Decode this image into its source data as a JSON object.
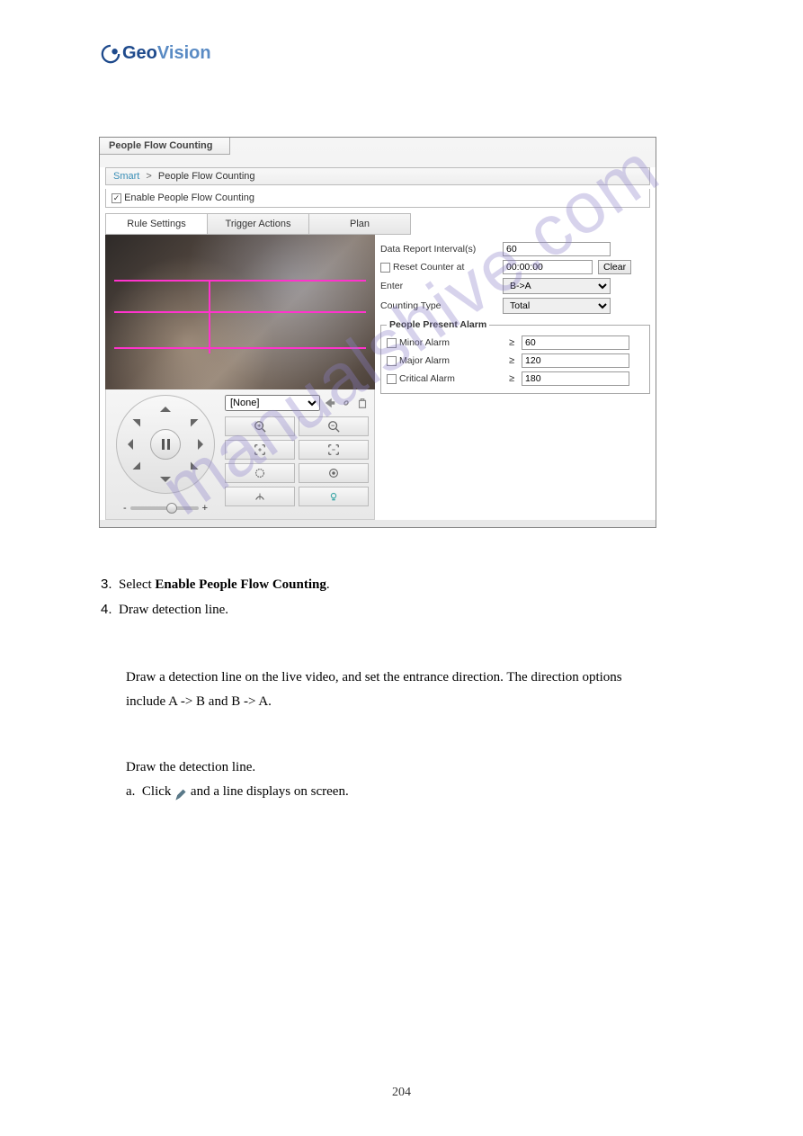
{
  "logo": {
    "brand_a": "Geo",
    "brand_b": "Vision"
  },
  "panel": {
    "tab_title": "People Flow Counting",
    "breadcrumb": {
      "link": "Smart",
      "sep": ">",
      "current": "People Flow Counting"
    },
    "enable_label": "Enable People Flow Counting",
    "tabs": {
      "rule": "Rule Settings",
      "trigger": "Trigger Actions",
      "plan": "Plan"
    },
    "preset_none": "[None]",
    "slider_minus": "-",
    "slider_plus": "+",
    "form": {
      "interval_label": "Data Report Interval(s)",
      "interval_value": "60",
      "reset_label": "Reset Counter at",
      "reset_value": "00:00:00",
      "clear_btn": "Clear",
      "enter_label": "Enter",
      "enter_value": "B->A",
      "counting_label": "Counting Type",
      "counting_value": "Total"
    },
    "alarm": {
      "legend": "People Present Alarm",
      "minor_label": "Minor Alarm",
      "minor_value": "60",
      "major_label": "Major Alarm",
      "major_value": "120",
      "critical_label": "Critical Alarm",
      "critical_value": "180",
      "ge": "≥"
    }
  },
  "body": {
    "p1_a": "3.",
    "p1_b": "Select ",
    "p1_c": "Enable People Flow Counting",
    "p1_d": ".",
    "p2_a": "4.",
    "p2_b": "Draw detection line.",
    "p3": "Draw a detection line on the live video, and set the entrance direction. The direction options include A -> B and B -> A.",
    "p4": "Draw the detection line.",
    "p5_a": "a.",
    "p5_b": "Click ",
    "p5_c": " and a line displays on screen."
  },
  "watermark": "manualshive.com",
  "page_num": "204"
}
